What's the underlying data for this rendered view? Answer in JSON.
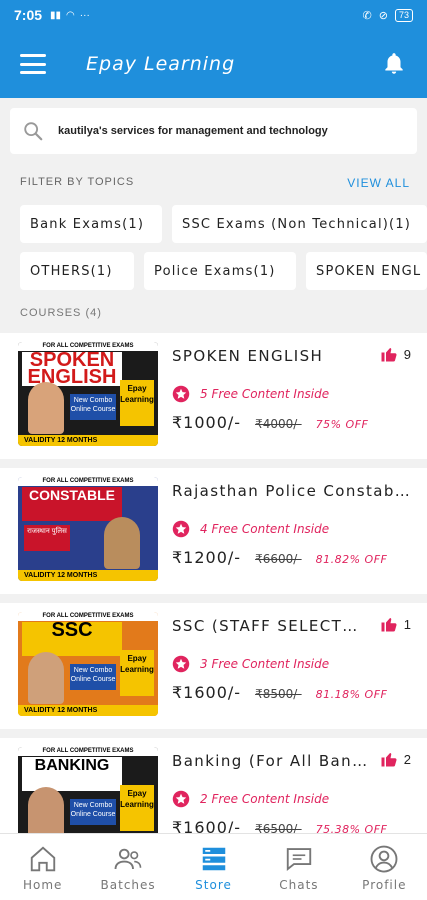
{
  "status": {
    "time": "7:05",
    "battery": "73"
  },
  "app": {
    "title": "Epay Learning"
  },
  "search": {
    "text": "kautilya's services for management and technology"
  },
  "filter": {
    "heading": "FILTER BY TOPICS",
    "view_all": "VIEW ALL",
    "chips": [
      "Bank Exams(1)",
      "SSC Exams (Non Technical)(1)",
      "OTHERS(1)",
      "Police Exams(1)",
      "SPOKEN ENGL"
    ]
  },
  "courses": {
    "heading": "COURSES (4)",
    "items": [
      {
        "title": "SPOKEN ENGLISH",
        "likes": "9",
        "free": "5 Free Content Inside",
        "price": "₹1000/-",
        "mrp": "₹4000/-",
        "off": "75% OFF",
        "thumb": {
          "band": "FOR ALL COMPETITIVE EXAMS",
          "headline": "SPOKEN ENGLISH",
          "brand": "Epay Learning",
          "combo": "New Combo Online Course",
          "validity": "VALIDITY 12 MONTHS"
        }
      },
      {
        "title": "Rajasthan Police Constable (...",
        "likes": "",
        "free": "4 Free Content Inside",
        "price": "₹1200/-",
        "mrp": "₹6600/-",
        "off": "81.82% OFF",
        "thumb": {
          "band": "FOR ALL COMPETITIVE EXAMS",
          "headline": "CONSTABLE",
          "brand": "",
          "combo": "राजस्थान पुलिस",
          "validity": "VALIDITY 12 MONTHS"
        }
      },
      {
        "title": "SSC (STAFF SELECTIO...",
        "likes": "1",
        "free": "3 Free Content Inside",
        "price": "₹1600/-",
        "mrp": "₹8500/-",
        "off": "81.18% OFF",
        "thumb": {
          "band": "FOR ALL COMPETITIVE EXAMS",
          "headline": "SSC",
          "brand": "Epay Learning",
          "combo": "New Combo Online Course",
          "validity": "VALIDITY 12 MONTHS"
        }
      },
      {
        "title": "Banking (For All Banks...",
        "likes": "2",
        "free": "2 Free Content Inside",
        "price": "₹1600/-",
        "mrp": "₹6500/-",
        "off": "75.38% OFF",
        "thumb": {
          "band": "FOR ALL COMPETITIVE EXAMS",
          "headline": "BANKING",
          "brand": "Epay Learning",
          "combo": "New Combo Online Course",
          "validity": ""
        }
      }
    ]
  },
  "nav": {
    "home": "Home",
    "batches": "Batches",
    "store": "Store",
    "chats": "Chats",
    "profile": "Profile"
  },
  "colors": {
    "primary": "#1f8fdc",
    "accent": "#e0245e"
  }
}
